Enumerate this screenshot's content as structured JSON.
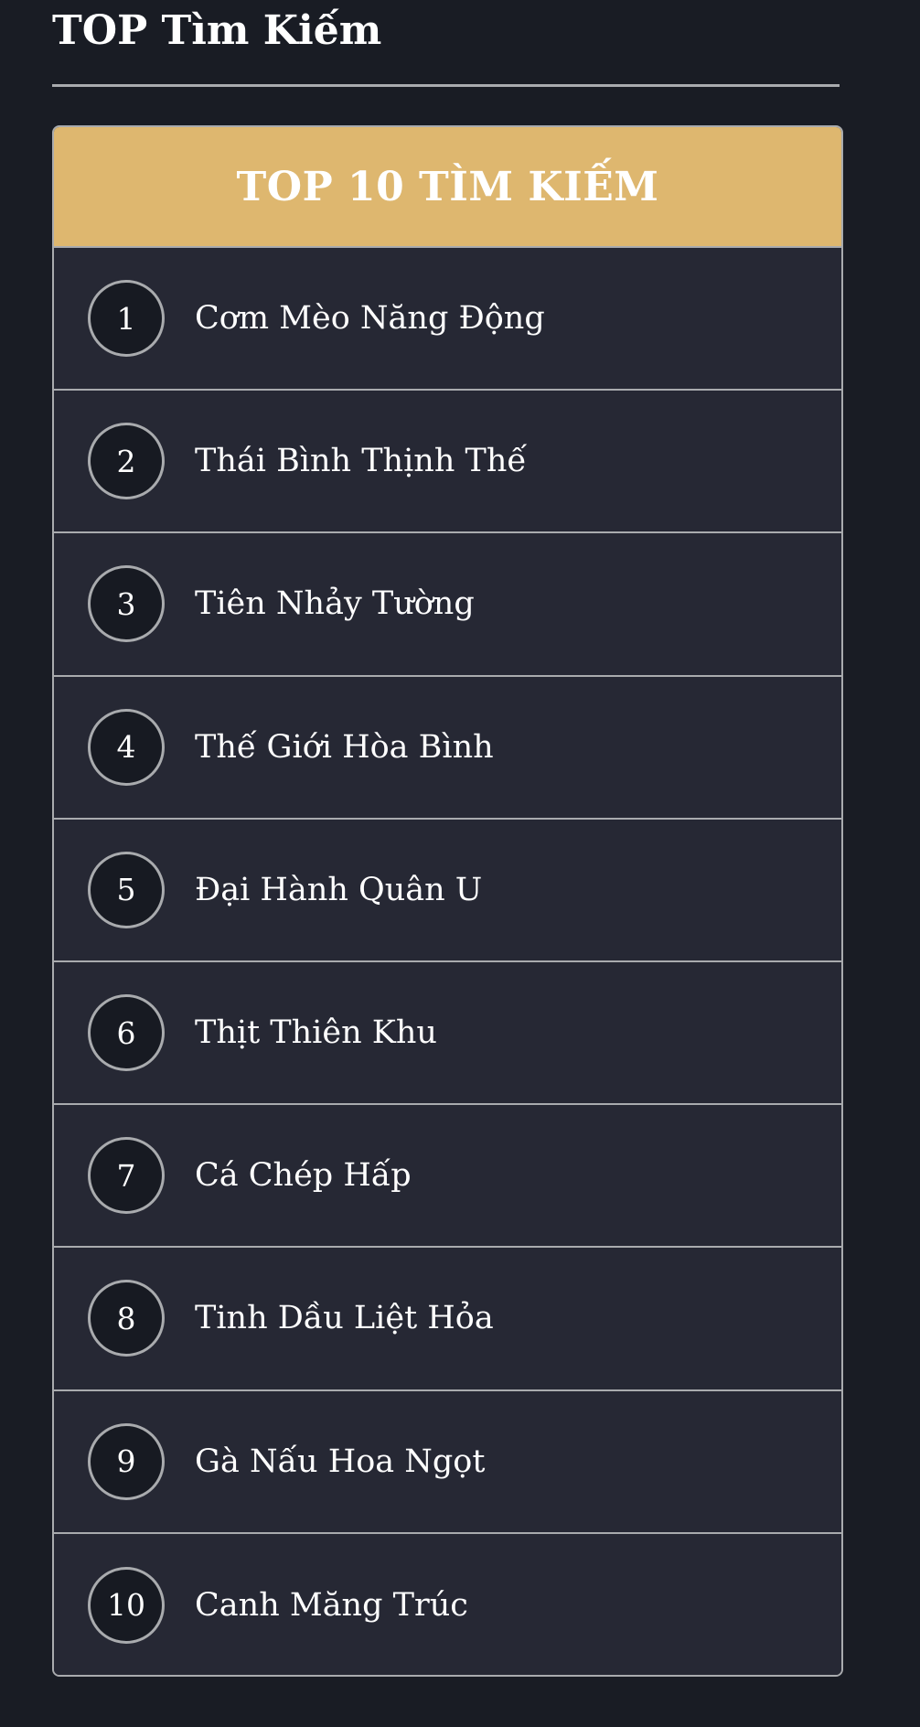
{
  "page": {
    "title": "TOP Tìm Kiếm"
  },
  "panel": {
    "header_title": "TOP 10 TÌM KIẾM",
    "items": [
      {
        "rank": "1",
        "name": "Cơm Mèo Năng Động"
      },
      {
        "rank": "2",
        "name": "Thái Bình Thịnh Thế"
      },
      {
        "rank": "3",
        "name": "Tiên Nhảy Tường"
      },
      {
        "rank": "4",
        "name": "Thế Giới Hòa Bình"
      },
      {
        "rank": "5",
        "name": "Đại Hành Quân U"
      },
      {
        "rank": "6",
        "name": "Thịt Thiên Khu"
      },
      {
        "rank": "7",
        "name": "Cá Chép Hấp"
      },
      {
        "rank": "8",
        "name": "Tinh Dầu Liệt Hỏa"
      },
      {
        "rank": "9",
        "name": "Gà Nấu Hoa Ngọt"
      },
      {
        "rank": "10",
        "name": "Canh Măng Trúc"
      }
    ]
  },
  "colors": {
    "background": "#191c24",
    "header_accent": "#deb76f",
    "row_background": "#262834",
    "border": "#a9abae",
    "badge_background": "#171a22",
    "text": "#ffffff"
  }
}
